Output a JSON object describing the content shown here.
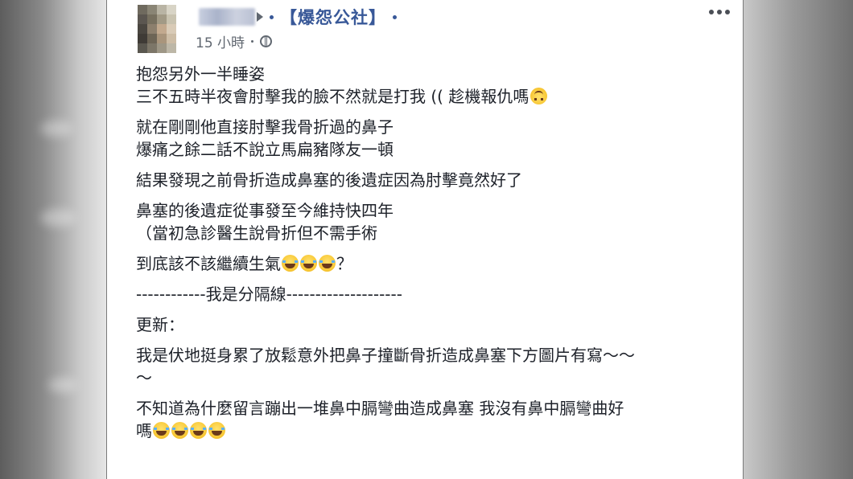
{
  "post": {
    "group_name": "【爆怨公社】",
    "time": "15 小時",
    "privacy_icon": "globe-icon",
    "more_icon": "more-dots-icon",
    "avatar_colors": [
      [
        "#6f6a5e",
        "#8a8575",
        "#b9b4a4",
        "#d8d4c6"
      ],
      [
        "#5b5650",
        "#77705f",
        "#a29a86",
        "#c9c3b0"
      ],
      [
        "#4a4640",
        "#8c7f6d",
        "#c2a98e",
        "#d9cbb7"
      ],
      [
        "#3f3b36",
        "#6d6556",
        "#a9957c",
        "#cdbda6"
      ],
      [
        "#5a574f",
        "#7c7668",
        "#9e9786",
        "#bdb7a7"
      ]
    ],
    "paragraphs": [
      {
        "lines": [
          {
            "text": "抱怨另外一半睡姿",
            "emoji": []
          },
          {
            "text": "三不五時半夜會肘擊我的臉不然就是打我 (( 趁機報仇嗎",
            "emoji": [
              "upside-down-face"
            ]
          }
        ]
      },
      {
        "lines": [
          {
            "text": "就在剛剛他直接肘擊我骨折過的鼻子",
            "emoji": []
          },
          {
            "text": "爆痛之餘二話不說立馬扁豬隊友一頓",
            "emoji": []
          }
        ]
      },
      {
        "lines": [
          {
            "text": "結果發現之前骨折造成鼻塞的後遺症因為肘擊竟然好了",
            "emoji": []
          }
        ]
      },
      {
        "lines": [
          {
            "text": "鼻塞的後遺症從事發至今維持快四年",
            "emoji": []
          },
          {
            "text": "（當初急診醫生說骨折但不需手術",
            "emoji": []
          }
        ]
      },
      {
        "lines": [
          {
            "text": "到底該不該繼續生氣",
            "emoji": [
              "tears-of-joy",
              "tears-of-joy",
              "tears-of-joy"
            ],
            "suffix": "？"
          }
        ]
      },
      {
        "lines": [
          {
            "text": "------------我是分隔線--------------------",
            "emoji": []
          }
        ]
      },
      {
        "lines": [
          {
            "text": "更新：",
            "emoji": []
          }
        ]
      },
      {
        "lines": [
          {
            "text": "我是伏地挺身累了放鬆意外把鼻子撞斷骨折造成鼻塞下方圖片有寫～～",
            "emoji": []
          },
          {
            "text": "～",
            "emoji": []
          }
        ]
      },
      {
        "lines": [
          {
            "text": "不知道為什麼留言蹦出一堆鼻中膈彎曲造成鼻塞 我沒有鼻中膈彎曲好",
            "emoji": []
          },
          {
            "text": "嗎",
            "emoji": [
              "tears-of-joy",
              "tears-of-joy",
              "tears-of-joy",
              "tears-of-joy"
            ]
          }
        ]
      }
    ]
  }
}
